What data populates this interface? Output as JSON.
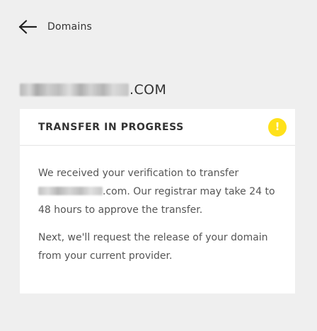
{
  "nav": {
    "back_label": "Domains",
    "back_icon": "arrow-left-icon"
  },
  "domain": {
    "name_suffix": ".COM"
  },
  "status_card": {
    "title": "TRANSFER IN PROGRESS",
    "alert_icon": "exclamation-icon",
    "alert_glyph": "!",
    "alert_color": "#ffe11a",
    "paragraph1_before": "We received your verification to transfer",
    "paragraph1_domain_suffix": ".com",
    "paragraph1_after": ". Our registrar may take 24 to 48 hours to approve the transfer.",
    "paragraph2": "Next, we'll request the release of your domain from your current provider."
  }
}
